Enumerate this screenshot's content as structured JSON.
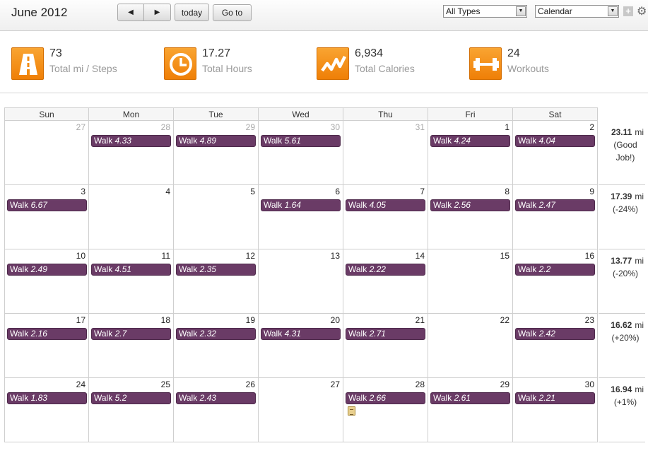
{
  "header": {
    "title": "June 2012",
    "prev_label": "◀",
    "next_label": "▶",
    "today_label": "today",
    "goto_label": "Go to",
    "types_select": "All Types",
    "view_select": "Calendar"
  },
  "stats": [
    {
      "value": "73",
      "label": "Total mi / Steps",
      "icon": "road-icon"
    },
    {
      "value": "17.27",
      "label": "Total Hours",
      "icon": "clock-icon"
    },
    {
      "value": "6,934",
      "label": "Total Calories",
      "icon": "trend-line-icon"
    },
    {
      "value": "24",
      "label": "Workouts",
      "icon": "dumbbell-icon"
    }
  ],
  "days_of_week": [
    "Sun",
    "Mon",
    "Tue",
    "Wed",
    "Thu",
    "Fri",
    "Sat"
  ],
  "colors": {
    "accent_orange": "#f28c12",
    "event_purple": "#6a3b66"
  },
  "weeks": [
    {
      "days": [
        {
          "num": "27",
          "other": true,
          "event": ""
        },
        {
          "num": "28",
          "other": true,
          "event": "Walk",
          "value": "4.33"
        },
        {
          "num": "29",
          "other": true,
          "event": "Walk",
          "value": "4.89"
        },
        {
          "num": "30",
          "other": true,
          "event": "Walk",
          "value": "5.61"
        },
        {
          "num": "31",
          "other": true,
          "event": ""
        },
        {
          "num": "1",
          "other": false,
          "event": "Walk",
          "value": "4.24"
        },
        {
          "num": "2",
          "other": false,
          "event": "Walk",
          "value": "4.04"
        }
      ],
      "summary": {
        "mi": "23.11",
        "unit": "mi",
        "note": "(Good Job!)"
      }
    },
    {
      "days": [
        {
          "num": "3",
          "other": false,
          "event": "Walk",
          "value": "6.67"
        },
        {
          "num": "4",
          "other": false,
          "event": ""
        },
        {
          "num": "5",
          "other": false,
          "event": ""
        },
        {
          "num": "6",
          "other": false,
          "event": "Walk",
          "value": "1.64"
        },
        {
          "num": "7",
          "other": false,
          "event": "Walk",
          "value": "4.05"
        },
        {
          "num": "8",
          "other": false,
          "event": "Walk",
          "value": "2.56"
        },
        {
          "num": "9",
          "other": false,
          "event": "Walk",
          "value": "2.47"
        }
      ],
      "summary": {
        "mi": "17.39",
        "unit": "mi",
        "note": "(-24%)"
      }
    },
    {
      "days": [
        {
          "num": "10",
          "other": false,
          "event": "Walk",
          "value": "2.49"
        },
        {
          "num": "11",
          "other": false,
          "event": "Walk",
          "value": "4.51"
        },
        {
          "num": "12",
          "other": false,
          "event": "Walk",
          "value": "2.35"
        },
        {
          "num": "13",
          "other": false,
          "event": ""
        },
        {
          "num": "14",
          "other": false,
          "event": "Walk",
          "value": "2.22"
        },
        {
          "num": "15",
          "other": false,
          "event": ""
        },
        {
          "num": "16",
          "other": false,
          "event": "Walk",
          "value": "2.2"
        }
      ],
      "summary": {
        "mi": "13.77",
        "unit": "mi",
        "note": "(-20%)"
      }
    },
    {
      "days": [
        {
          "num": "17",
          "other": false,
          "event": "Walk",
          "value": "2.16"
        },
        {
          "num": "18",
          "other": false,
          "event": "Walk",
          "value": "2.7"
        },
        {
          "num": "19",
          "other": false,
          "event": "Walk",
          "value": "2.32"
        },
        {
          "num": "20",
          "other": false,
          "event": "Walk",
          "value": "4.31"
        },
        {
          "num": "21",
          "other": false,
          "event": "Walk",
          "value": "2.71"
        },
        {
          "num": "22",
          "other": false,
          "event": ""
        },
        {
          "num": "23",
          "other": false,
          "event": "Walk",
          "value": "2.42"
        }
      ],
      "summary": {
        "mi": "16.62",
        "unit": "mi",
        "note": "(+20%)"
      }
    },
    {
      "days": [
        {
          "num": "24",
          "other": false,
          "event": "Walk",
          "value": "1.83"
        },
        {
          "num": "25",
          "other": false,
          "event": "Walk",
          "value": "5.2"
        },
        {
          "num": "26",
          "other": false,
          "event": "Walk",
          "value": "2.43"
        },
        {
          "num": "27",
          "other": false,
          "event": ""
        },
        {
          "num": "28",
          "other": false,
          "event": "Walk",
          "value": "2.66",
          "note_icon": true
        },
        {
          "num": "29",
          "other": false,
          "event": "Walk",
          "value": "2.61"
        },
        {
          "num": "30",
          "other": false,
          "event": "Walk",
          "value": "2.21"
        }
      ],
      "summary": {
        "mi": "16.94",
        "unit": "mi",
        "note": "(+1%)"
      }
    }
  ]
}
